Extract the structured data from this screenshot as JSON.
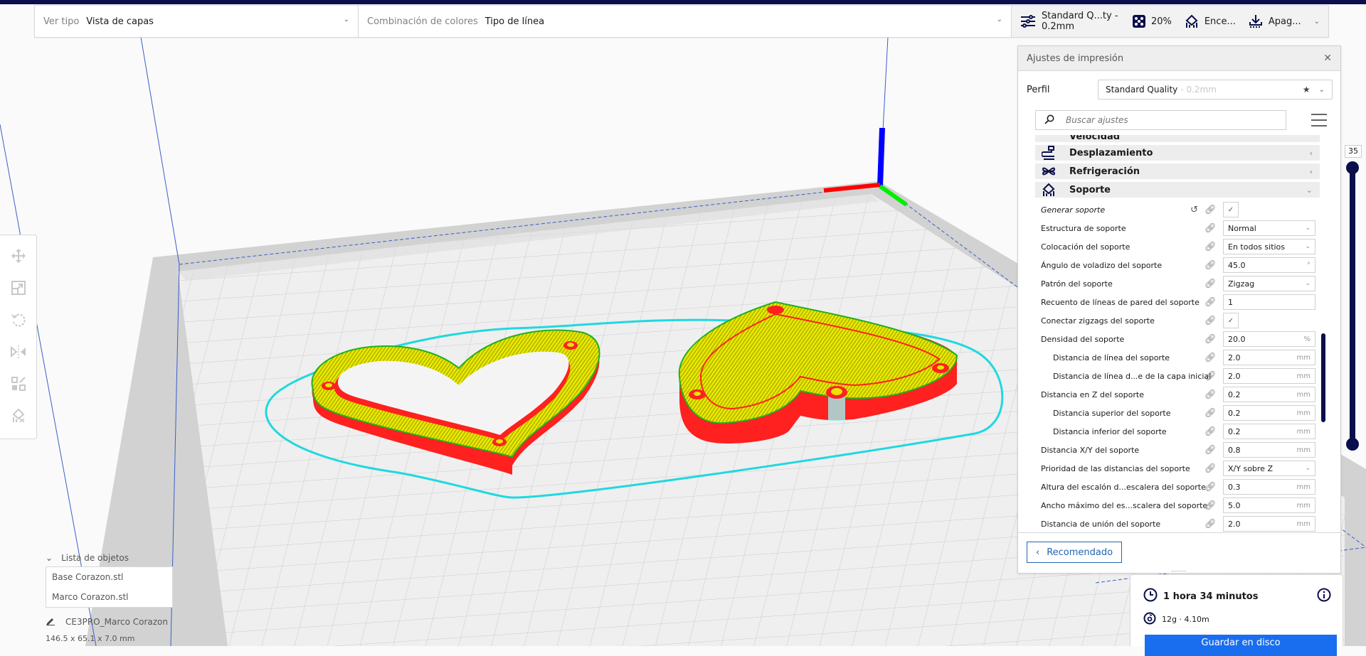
{
  "stage_menu": {
    "view_type": {
      "label": "Ver tipo",
      "value": "Vista de capas"
    },
    "color_scheme": {
      "label": "Combinación de colores",
      "value": "Tipo de línea"
    },
    "print_setup": {
      "profile": "Standard Q...ty - 0.2mm",
      "infill": "20%",
      "support": "Ence...",
      "adhesion": "Apag..."
    }
  },
  "colors": {
    "accent": "#196ef0",
    "nav": "#0a0e4a",
    "wall_outer": "#ff2020",
    "infill": "#e6e600",
    "wall_inner": "#20c020",
    "skirt": "#20e0e0",
    "axis_x": "#ff0000",
    "axis_y": "#00ff00",
    "axis_z": "#0000ff"
  },
  "toolbar": {
    "tools": [
      {
        "name": "move-tool",
        "icon": "move-icon"
      },
      {
        "name": "scale-tool",
        "icon": "scale-icon"
      },
      {
        "name": "rotate-tool",
        "icon": "rotate-icon"
      },
      {
        "name": "mirror-tool",
        "icon": "mirror-icon"
      },
      {
        "name": "per-model-settings-tool",
        "icon": "per-model-settings-icon"
      },
      {
        "name": "support-blocker-tool",
        "icon": "support-blocker-icon"
      }
    ]
  },
  "object_list": {
    "title": "Lista de objetos",
    "items": [
      "Base Corazon.stl",
      "Marco Corazon.stl"
    ],
    "job_name": "CE3PRO_Marco Corazon",
    "dimensions": "146.5 x 65.1 x 7.0 mm"
  },
  "print_settings": {
    "title": "Ajustes de impresión",
    "profile_label": "Perfil",
    "profile_name": "Standard Quality",
    "profile_suffix": "- 0.2mm",
    "search_placeholder": "Buscar ajustes",
    "categories": [
      {
        "label": "Velocidad",
        "expanded": false
      },
      {
        "label": "Desplazamiento",
        "expanded": false
      },
      {
        "label": "Refrigeración",
        "expanded": false
      },
      {
        "label": "Soporte",
        "expanded": true
      }
    ],
    "settings": [
      {
        "label": "Generar soporte",
        "type": "checkbox",
        "checked": true,
        "italic": true,
        "reset": true
      },
      {
        "label": "Estructura de soporte",
        "type": "select",
        "value": "Normal"
      },
      {
        "label": "Colocación del soporte",
        "type": "select",
        "value": "En todos sitios"
      },
      {
        "label": "Ángulo de voladizo del soporte",
        "type": "number",
        "value": "45.0",
        "unit": "°"
      },
      {
        "label": "Patrón del soporte",
        "type": "select",
        "value": "Zigzag"
      },
      {
        "label": "Recuento de líneas de pared del soporte",
        "type": "number",
        "value": "1",
        "unit": ""
      },
      {
        "label": "Conectar zigzags del soporte",
        "type": "checkbox",
        "checked": true
      },
      {
        "label": "Densidad del soporte",
        "type": "number",
        "value": "20.0",
        "unit": "%"
      },
      {
        "label": "Distancia de línea del soporte",
        "type": "number",
        "value": "2.0",
        "unit": "mm",
        "indent": true
      },
      {
        "label": "Distancia de línea d...e de la capa inicial",
        "type": "number",
        "value": "2.0",
        "unit": "mm",
        "indent": true
      },
      {
        "label": "Distancia en Z del soporte",
        "type": "number",
        "value": "0.2",
        "unit": "mm"
      },
      {
        "label": "Distancia superior del soporte",
        "type": "number",
        "value": "0.2",
        "unit": "mm",
        "indent": true
      },
      {
        "label": "Distancia inferior del soporte",
        "type": "number",
        "value": "0.2",
        "unit": "mm",
        "indent": true
      },
      {
        "label": "Distancia X/Y del soporte",
        "type": "number",
        "value": "0.8",
        "unit": "mm"
      },
      {
        "label": "Prioridad de las distancias del soporte",
        "type": "select",
        "value": "X/Y sobre Z"
      },
      {
        "label": "Altura del escalón d...escalera del soporte",
        "type": "number",
        "value": "0.3",
        "unit": "mm"
      },
      {
        "label": "Ancho máximo del es...scalera del soporte",
        "type": "number",
        "value": "5.0",
        "unit": "mm"
      },
      {
        "label": "Distancia de unión del soporte",
        "type": "number",
        "value": "2.0",
        "unit": "mm"
      }
    ],
    "recommended_button": "Recomendado"
  },
  "layer_slider": {
    "value": "35",
    "max_layer_fraction": 1.0
  },
  "output": {
    "print_time": "1 hora 34 minutos",
    "material": "12g · 4.10m",
    "save_button": "Guardar en disco"
  }
}
